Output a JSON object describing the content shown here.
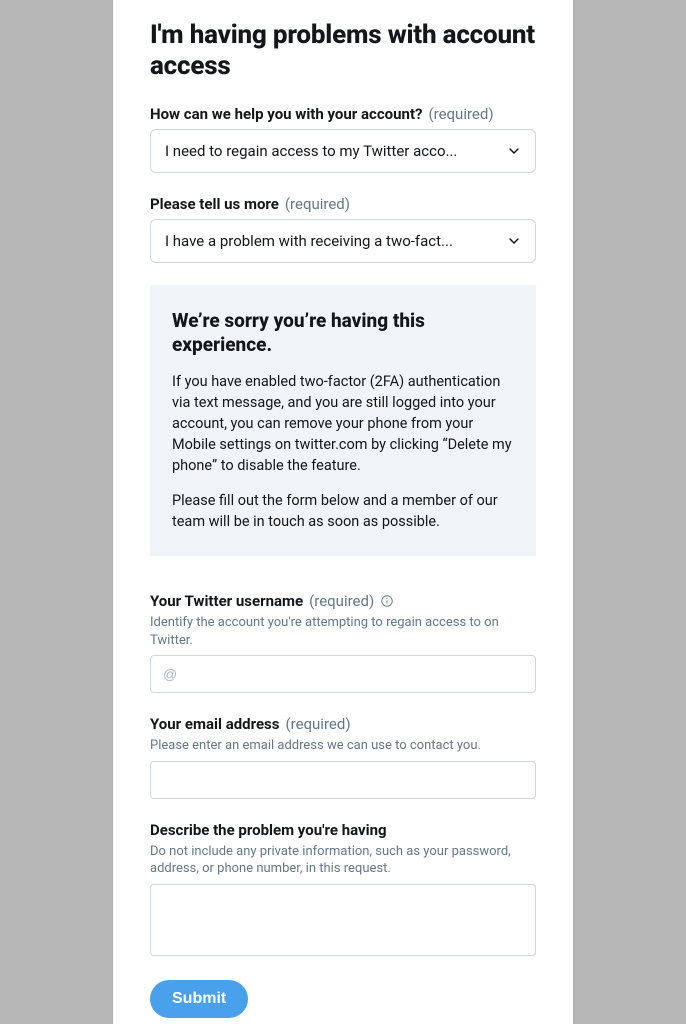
{
  "title": "I'm having problems with account access",
  "required_suffix": "(required)",
  "dropdown1": {
    "label": "How can we help you with your account?",
    "value": "I need to regain access to my Twitter acco..."
  },
  "dropdown2": {
    "label": "Please tell us more",
    "value": "I have a problem with receiving a two-fact..."
  },
  "notice": {
    "heading": "We’re sorry you’re having this experience.",
    "p1": "If you have enabled two-factor (2FA) authentication via text message, and you are still logged into your account, you can remove your phone from your Mobile settings on twitter.com by clicking “Delete my phone” to disable the feature.",
    "p2": "Please fill out the form below and a member of our team will be in touch as soon as possible."
  },
  "username": {
    "label": "Your Twitter username",
    "help": "Identify the account you're attempting to regain access to on Twitter.",
    "placeholder": "@"
  },
  "email": {
    "label": "Your email address",
    "help": "Please enter an email address we can use to contact you."
  },
  "describe": {
    "label": "Describe the problem you're having",
    "help": "Do not include any private information, such as your password, address, or phone number, in this request."
  },
  "submit_label": "Submit"
}
